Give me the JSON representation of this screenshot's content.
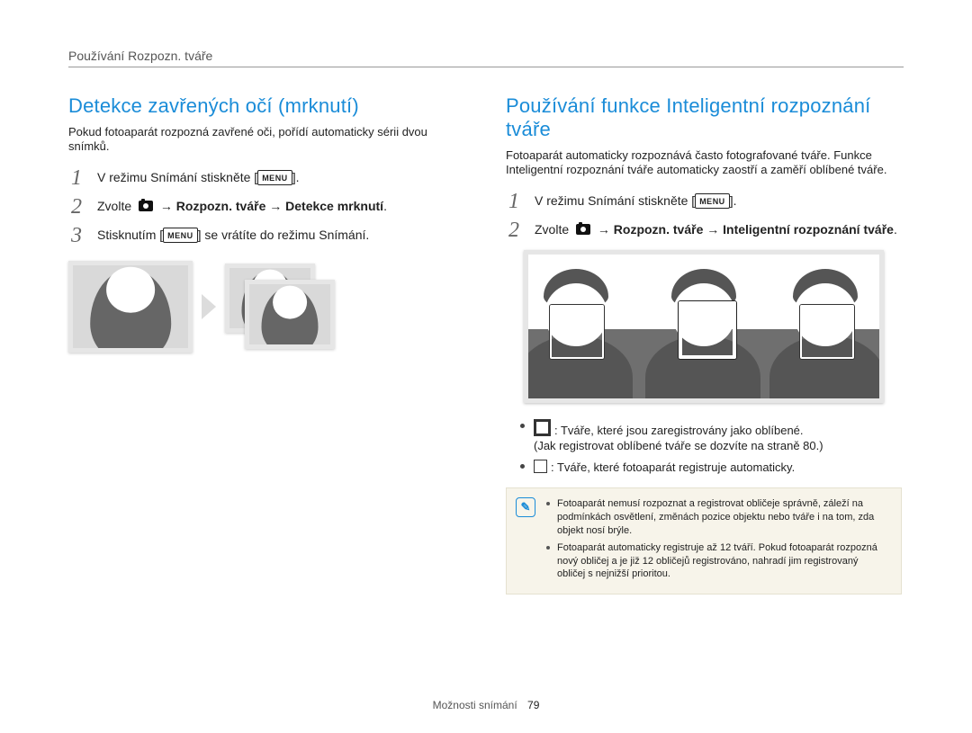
{
  "header": {
    "title": "Používání Rozpozn. tváře"
  },
  "left": {
    "title": "Detekce zavřených očí (mrknutí)",
    "intro": "Pokud fotoaparát rozpozná zavřené oči, pořídí automaticky sérii dvou snímků.",
    "steps": {
      "s1": "V režimu Snímání stiskněte [",
      "s1_suffix": "].",
      "s2_prefix": "Zvolte ",
      "s2_mid": " → Rozpozn. tváře → Detekce mrknutí",
      "s2_suffix": ".",
      "s3_prefix": "Stisknutím [",
      "s3_suffix": "] se vrátíte do režimu Snímání."
    }
  },
  "right": {
    "title": "Používání funkce Inteligentní rozpoznání tváře",
    "intro": "Fotoaparát automaticky rozpoznává často fotografované tváře. Funkce Inteligentní rozpoznání tváře automaticky zaostří a zaměří oblíbené tváře.",
    "steps": {
      "s1": "V režimu Snímání stiskněte [",
      "s1_suffix": "].",
      "s2_prefix": "Zvolte ",
      "s2_mid": " → Rozpozn. tváře → Inteligentní rozpoznání tváře",
      "s2_suffix": "."
    },
    "legend": {
      "thick_text": ": Tváře, které jsou zaregistrovány jako oblíbené.",
      "thick_sub": "(Jak registrovat oblíbené tváře se dozvíte na straně 80.)",
      "thin_text": ": Tváře, které fotoaparát registruje automaticky."
    },
    "notes": {
      "n1": "Fotoaparát nemusí rozpoznat a registrovat obličeje správně, záleží na podmínkách osvětlení, změnách pozice objektu nebo tváře i na tom, zda objekt nosí brýle.",
      "n2": "Fotoaparát automaticky registruje až 12 tváří. Pokud fotoaparát rozpozná nový obličej a je již 12 obličejů registrováno, nahradí jim registrovaný obličej s nejnižší prioritou."
    }
  },
  "footer": {
    "section": "Možnosti snímání",
    "page": "79"
  },
  "labels": {
    "menu": "MENU"
  }
}
